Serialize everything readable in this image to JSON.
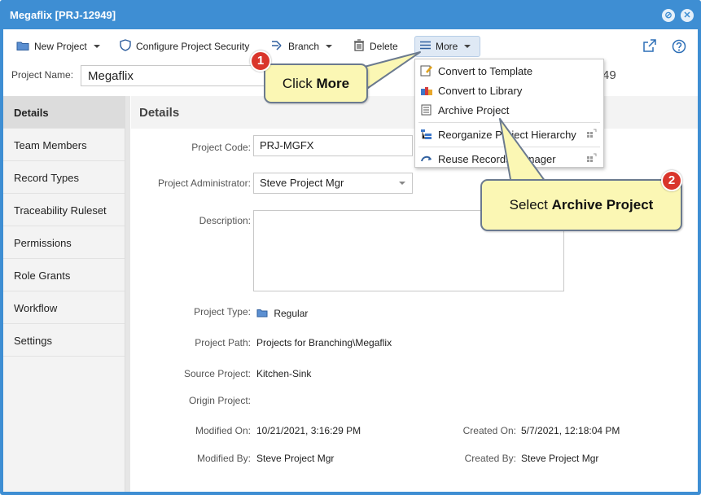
{
  "window": {
    "title": "Megaflix [PRJ-12949]"
  },
  "toolbar": {
    "new_project": "New Project",
    "configure_security": "Configure Project Security",
    "branch": "Branch",
    "delete": "Delete",
    "more": "More"
  },
  "project_name": {
    "label": "Project Name:",
    "value": "Megaflix",
    "suffix": "49"
  },
  "sidebar": {
    "items": [
      {
        "label": "Details"
      },
      {
        "label": "Team Members"
      },
      {
        "label": "Record Types"
      },
      {
        "label": "Traceability Ruleset"
      },
      {
        "label": "Permissions"
      },
      {
        "label": "Role Grants"
      },
      {
        "label": "Workflow"
      },
      {
        "label": "Settings"
      }
    ]
  },
  "details": {
    "title": "Details",
    "project_code_label": "Project Code:",
    "project_code_value": "PRJ-MGFX",
    "project_admin_label": "Project Administrator:",
    "project_admin_value": "Steve Project Mgr",
    "description_label": "Description:",
    "project_type_label": "Project Type:",
    "project_type_value": "Regular",
    "project_path_label": "Project Path:",
    "project_path_value": "Projects for Branching\\Megaflix",
    "source_project_label": "Source Project:",
    "source_project_value": "Kitchen-Sink",
    "origin_project_label": "Origin Project:",
    "modified_on_label": "Modified On:",
    "modified_on_value": "10/21/2021, 3:16:29 PM",
    "created_on_label": "Created On:",
    "created_on_value": "5/7/2021, 12:18:04 PM",
    "modified_by_label": "Modified By:",
    "modified_by_value": "Steve Project Mgr",
    "created_by_label": "Created By:",
    "created_by_value": "Steve Project Mgr"
  },
  "more_menu": {
    "convert_template": "Convert to Template",
    "convert_library": "Convert to Library",
    "archive": "Archive Project",
    "reorganize": "Reorganize Project Hierarchy",
    "reuse": "Reuse Records Manager"
  },
  "callouts": {
    "step1_number": "1",
    "step1_text_prefix": "Click ",
    "step1_text_bold": "More",
    "step2_number": "2",
    "step2_text_prefix": "Select ",
    "step2_text_bold": "Archive Project"
  },
  "colors": {
    "titlebar": "#3e8ed3",
    "callout_fill": "#fbf7b4",
    "badge": "#d9352b"
  }
}
